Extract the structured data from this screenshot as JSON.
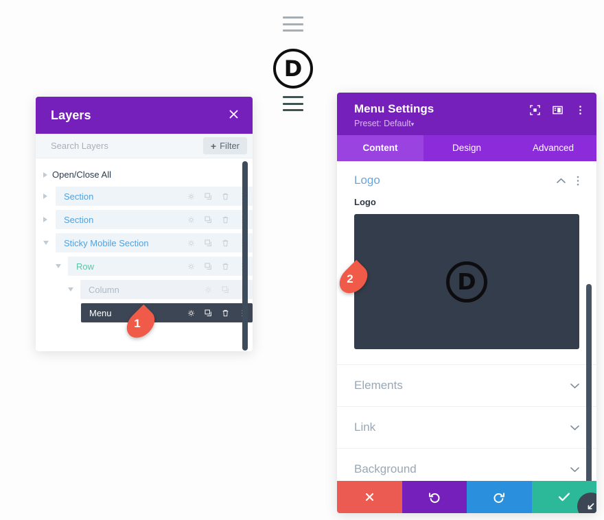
{
  "page": {
    "app": "Divi Visual Builder",
    "logo_letter": "D"
  },
  "layers_panel": {
    "title": "Layers",
    "close_icon": "close-icon",
    "search": {
      "placeholder": "Search Layers",
      "value": ""
    },
    "filter_button": {
      "plus": "+",
      "label": "Filter"
    },
    "open_close_all": "Open/Close All",
    "rows": [
      {
        "label": "Section",
        "type": "section",
        "indent": 1,
        "expanded": false,
        "state": "normal",
        "icons": [
          "gear-icon",
          "duplicate-icon",
          "trash-icon",
          "more-options-icon"
        ]
      },
      {
        "label": "Section",
        "type": "section",
        "indent": 1,
        "expanded": false,
        "state": "normal",
        "icons": [
          "gear-icon",
          "duplicate-icon",
          "trash-icon",
          "more-options-icon"
        ]
      },
      {
        "label": "Sticky Mobile Section",
        "type": "section",
        "indent": 1,
        "expanded": true,
        "state": "normal",
        "icons": [
          "gear-icon",
          "duplicate-icon",
          "trash-icon",
          "more-options-icon"
        ]
      },
      {
        "label": "Row",
        "type": "row",
        "indent": 2,
        "expanded": true,
        "state": "normal",
        "icons": [
          "gear-icon",
          "duplicate-icon",
          "trash-icon",
          "more-options-icon"
        ]
      },
      {
        "label": "Column",
        "type": "column",
        "indent": 3,
        "expanded": true,
        "state": "faded",
        "icons": [
          "gear-icon",
          "duplicate-icon",
          "more-options-icon"
        ]
      },
      {
        "label": "Menu",
        "type": "module",
        "indent": 4,
        "expanded": null,
        "state": "highlighted",
        "icons": [
          "gear-icon",
          "duplicate-icon",
          "trash-icon",
          "more-options-icon"
        ]
      }
    ]
  },
  "settings_panel": {
    "title": "Menu Settings",
    "preset_label": "Preset: Default",
    "preset_caret": "▾",
    "header_icons": [
      "focus-icon",
      "panel-layout-icon",
      "more-options-icon"
    ],
    "tabs": [
      {
        "label": "Content",
        "active": true
      },
      {
        "label": "Design",
        "active": false
      },
      {
        "label": "Advanced",
        "active": false
      }
    ],
    "open_section": {
      "title": "Logo",
      "collapse_icon": "chevron-up-icon",
      "options_icon": "more-options-icon",
      "field_label": "Logo",
      "preview_letter": "D"
    },
    "collapsed_sections": [
      {
        "title": "Elements",
        "icon": "chevron-down-icon"
      },
      {
        "title": "Link",
        "icon": "chevron-down-icon"
      },
      {
        "title": "Background",
        "icon": "chevron-down-icon"
      }
    ],
    "footer_buttons": [
      {
        "name": "cancel",
        "icon": "close-icon",
        "color": "#ec5b52"
      },
      {
        "name": "undo",
        "icon": "undo-icon",
        "color": "#7620bb"
      },
      {
        "name": "redo",
        "icon": "redo-icon",
        "color": "#2a8fdd"
      },
      {
        "name": "save",
        "icon": "check-icon",
        "color": "#2bb999"
      }
    ],
    "resize_handle_icon": "resize-diagonal-icon"
  },
  "callouts": [
    {
      "number": "1",
      "target": "menu-row-gear-icon"
    },
    {
      "number": "2",
      "target": "logo-preview"
    }
  ],
  "colors": {
    "purple": "#7620bb",
    "tab_bar": "#8c2bd9",
    "tab_active": "#9a43e0",
    "layer_blue": "#56a0d9",
    "layer_green": "#5ec4a6",
    "dark_row": "#3c4655",
    "preview_bg": "#343d4b",
    "callout_red": "#ef5b48"
  }
}
